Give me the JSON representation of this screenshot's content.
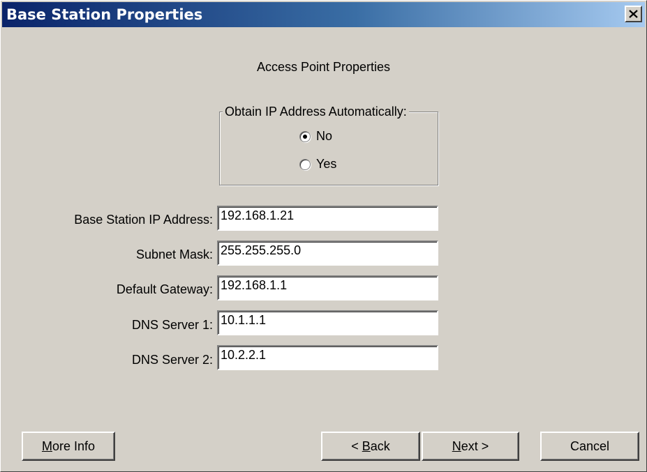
{
  "window": {
    "title": "Base Station Properties",
    "close_label": "Close"
  },
  "main": {
    "heading": "Access Point Properties"
  },
  "ip_group": {
    "legend": "Obtain IP Address Automatically:",
    "options": [
      {
        "label": "No",
        "checked": true
      },
      {
        "label": "Yes",
        "checked": false
      }
    ]
  },
  "fields": [
    {
      "label": "Base Station IP Address:",
      "value": "192.168.1.21"
    },
    {
      "label": "Subnet Mask:",
      "value": "255.255.255.0"
    },
    {
      "label": "Default Gateway:",
      "value": "192.168.1.1"
    },
    {
      "label": "DNS Server 1:",
      "value": "10.1.1.1"
    },
    {
      "label": "DNS Server 2:",
      "value": "10.2.2.1"
    }
  ],
  "buttons": {
    "more_info": {
      "prefix": "",
      "mnemonic": "M",
      "rest": "ore Info"
    },
    "back": {
      "prefix": "< ",
      "mnemonic": "B",
      "rest": "ack"
    },
    "next": {
      "prefix": "",
      "mnemonic": "N",
      "rest": "ext >"
    },
    "cancel": {
      "prefix": "",
      "mnemonic": "",
      "rest": "Cancel"
    }
  },
  "colors": {
    "titlebar_start": "#0a246a",
    "titlebar_end": "#a6caf0",
    "dialog_face": "#d4d0c8"
  }
}
